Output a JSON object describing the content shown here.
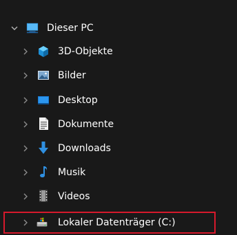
{
  "tree": {
    "root": {
      "label": "Dieser PC",
      "icon": "monitor-icon",
      "expanded": true
    },
    "children": [
      {
        "label": "3D-Objekte",
        "icon": "cube-3d-icon"
      },
      {
        "label": "Bilder",
        "icon": "pictures-icon"
      },
      {
        "label": "Desktop",
        "icon": "desktop-icon"
      },
      {
        "label": "Dokumente",
        "icon": "document-icon"
      },
      {
        "label": "Downloads",
        "icon": "download-arrow-icon"
      },
      {
        "label": "Musik",
        "icon": "music-note-icon"
      },
      {
        "label": "Videos",
        "icon": "film-icon"
      },
      {
        "label": "Lokaler Datenträger (C:)",
        "icon": "windows-drive-icon",
        "highlighted": true
      }
    ]
  },
  "colors": {
    "background": "#191919",
    "text": "#ffffff",
    "chevron": "#8c8c8c",
    "highlight_border": "#d7192c"
  }
}
